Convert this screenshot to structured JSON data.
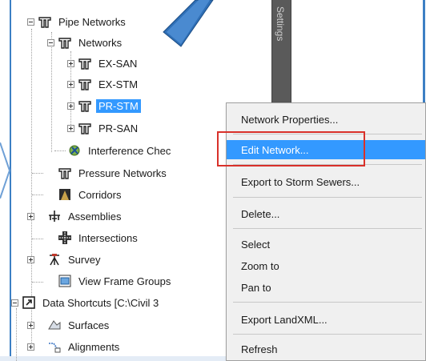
{
  "settings_tab": {
    "label": "Settings"
  },
  "tree": {
    "pipe_networks": "Pipe Networks",
    "networks": "Networks",
    "ex_san": "EX-SAN",
    "ex_stm": "EX-STM",
    "pr_stm": "PR-STM",
    "pr_san": "PR-SAN",
    "interference": "Interference Chec",
    "pressure_networks": "Pressure Networks",
    "corridors": "Corridors",
    "assemblies": "Assemblies",
    "intersections": "Intersections",
    "survey": "Survey",
    "view_frame_groups": "View Frame Groups",
    "data_shortcuts": "Data Shortcuts [C:\\Civil 3",
    "surfaces": "Surfaces",
    "alignments": "Alignments"
  },
  "context_menu": {
    "network_properties": "Network Properties...",
    "edit_network": "Edit Network...",
    "export_storm": "Export to Storm Sewers...",
    "delete": "Delete...",
    "select": "Select",
    "zoom_to": "Zoom to",
    "pan_to": "Pan to",
    "export_landxml": "Export LandXML...",
    "refresh": "Refresh"
  },
  "colors": {
    "accent": "#3399ff",
    "highlight_box": "#d9312a",
    "frame": "#3c7fc4"
  }
}
